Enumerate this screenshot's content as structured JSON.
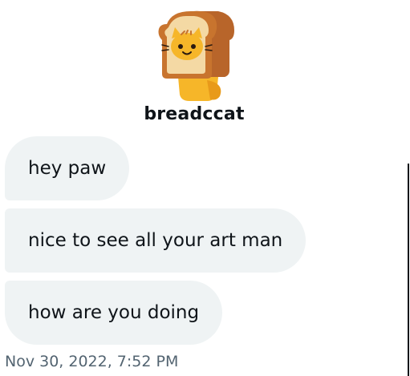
{
  "user": {
    "name": "breadccat",
    "avatar_icon": "bread-cat-icon"
  },
  "messages": [
    {
      "text": "hey paw"
    },
    {
      "text": "nice to see all your art man"
    },
    {
      "text": "how are you doing"
    }
  ],
  "timestamp": "Nov 30, 2022, 7:52 PM",
  "colors": {
    "bubble_bg": "#eff3f4",
    "text": "#0f1419",
    "secondary_text": "#536471"
  }
}
